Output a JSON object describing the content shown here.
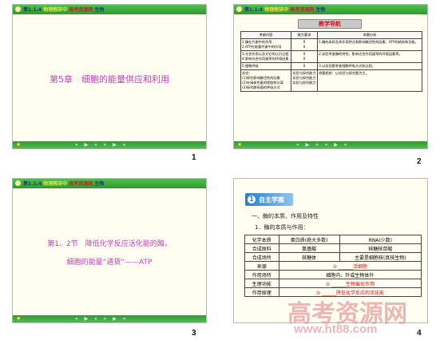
{
  "header": {
    "text_prefix": "第1.1.4",
    "text_middle": "物理教研中",
    "text_brand": "高考资源网",
    "text_suffix": "生物"
  },
  "footer": {
    "arrows": "« ▶ « » ▶ »"
  },
  "slides": [
    {
      "page": "1",
      "title": "第5章　细胞的能量供应和利用"
    },
    {
      "page": "2",
      "goal_title": "教学导航",
      "table_headers": [
        "考纲内容",
        "能力要求",
        "命题分析"
      ],
      "rows": [
        [
          "1.酶在代谢中的作用\n2.ATP在能量代谢中的作用",
          "Ⅱ\nⅡ",
          "1.酶的本质及其作用特点和影响酶活性的因素、ATP的结构和功能。"
        ],
        [
          "3.光合作用以及对它的认识过程\n4.影响光合作用速率的环境因素",
          "Ⅱ\nⅡ",
          "2.实验考查酶的特性，影响光合作用速率的环境因素等。"
        ],
        [
          "5.细胞呼吸",
          "Ⅱ",
          "3.以实验题考查细胞呼吸方式和过程。"
        ],
        [
          "实验：\n(1)探究影响酶活性的因素\n(2)叶绿体色素的提取和分离\n(3)探究酵母菌的呼吸方式",
          "实验与探究能力\n实验与探究能力\n实验与探究能力",
          "命题趋势：以实验与探究题为主。"
        ]
      ]
    },
    {
      "page": "3",
      "line1": "第1、2节　降低化学反应活化能的酶，",
      "line2": "细胞的能量“通货”——ATP"
    },
    {
      "page": "4",
      "section_num": "1",
      "section_title": "自主学案",
      "heading": "一、酶的本质、作用及特性",
      "sub": "1．酶的本质与作用：",
      "table": [
        [
          "化学本质",
          "蛋白质(绝大多数)",
          "RNA(少数)"
        ],
        [
          "合成原料",
          "氨基酸",
          "核糖核苷酸"
        ],
        [
          "合成场所",
          "核糖体",
          "主要是细胞核(真核生物)"
        ],
        [
          "来源",
          "① ______活细胞",
          ""
        ],
        [
          "作用场所",
          "细胞内、外或生物体外",
          ""
        ],
        [
          "生理功能",
          "② ______生物催化作用",
          ""
        ],
        [
          "作用原理",
          "③ ______降低化学反应的活化能",
          ""
        ]
      ],
      "watermark_cn": "高考资源网",
      "watermark_url": "www.ht88.com"
    }
  ]
}
